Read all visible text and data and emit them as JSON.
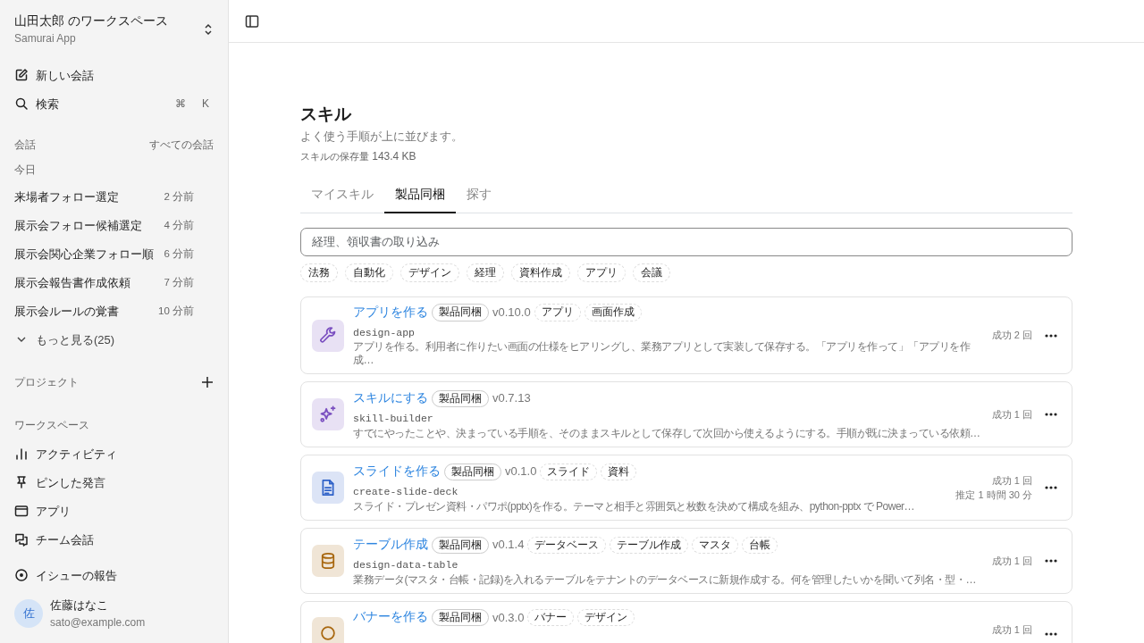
{
  "sidebar": {
    "workspace": {
      "title": "山田太郎 のワークスペース",
      "subtitle": "Samurai App"
    },
    "actions": [
      {
        "label": "新しい会話"
      },
      {
        "label": "検索",
        "keys": [
          "⌘",
          "K"
        ]
      }
    ],
    "conversations": {
      "heading": "会話",
      "link": "すべての会話",
      "group": "今日",
      "items": [
        {
          "title": "来場者フォロー選定",
          "time": "2 分前"
        },
        {
          "title": "展示会フォロー候補選定",
          "time": "4 分前"
        },
        {
          "title": "展示会関心企業フォロー順",
          "time": "6 分前"
        },
        {
          "title": "展示会報告書作成依頼",
          "time": "7 分前"
        },
        {
          "title": "展示会ルールの覚書",
          "time": "10 分前"
        }
      ],
      "more": "もっと見る(25)"
    },
    "projects": {
      "heading": "プロジェクト"
    },
    "workspace_section": {
      "heading": "ワークスペース",
      "items": [
        {
          "label": "アクティビティ"
        },
        {
          "label": "ピンした発言"
        },
        {
          "label": "アプリ"
        },
        {
          "label": "チーム会話"
        }
      ]
    },
    "report": {
      "label": "イシューの報告"
    },
    "user": {
      "initial": "佐",
      "name": "佐藤はなこ",
      "email": "sato@example.com"
    }
  },
  "page": {
    "title": "スキル",
    "subtitle": "よく使う手順が上に並びます。",
    "storage_label": "スキルの保存量",
    "storage_value": "143.4 KB",
    "tabs": [
      {
        "label": "マイスキル",
        "selected": false
      },
      {
        "label": "製品同梱",
        "selected": true
      },
      {
        "label": "探す",
        "selected": false
      }
    ],
    "search": {
      "placeholder": "経理、領収書の取り込み"
    },
    "filters": [
      "法務",
      "自動化",
      "デザイン",
      "経理",
      "資料作成",
      "アプリ",
      "会議"
    ],
    "skills": [
      {
        "color": "#7a4fc0",
        "title": "アプリを作る",
        "badge": "製品同梱",
        "version": "v0.10.0",
        "tags": [
          "アプリ",
          "画面作成"
        ],
        "code": "design-app",
        "description": "アプリを作る。利用者に作りたい画面の仕様をヒアリングし、業務アプリとして実装して保存する。「アプリを作って」「アプリを作成…",
        "stats": [
          "成功 2 回"
        ]
      },
      {
        "color": "#7a4fc0",
        "title": "スキルにする",
        "badge": "製品同梱",
        "version": "v0.7.13",
        "code": "skill-builder",
        "description": "すでにやったことや、決まっている手順を、そのままスキルとして保存して次回から使えるようにする。手順が既に決まっている依頼…",
        "stats": [
          "成功 1 回"
        ]
      },
      {
        "color": "#2f62c8",
        "title": "スライドを作る",
        "badge": "製品同梱",
        "version": "v0.1.0",
        "tags": [
          "スライド",
          "資料"
        ],
        "code": "create-slide-deck",
        "description": "スライド・プレゼン資料・パワポ(pptx)を作る。テーマと相手と雰囲気と枚数を決めて構成を組み、python-pptx で Power…",
        "stats": [
          "成功 1 回",
          "推定 1 時間 30 分"
        ]
      },
      {
        "color": "#a8670f",
        "title": "テーブル作成",
        "badge": "製品同梱",
        "version": "v0.1.4",
        "tags": [
          "データベース",
          "テーブル作成",
          "マスタ",
          "台帳"
        ],
        "code": "design-data-table",
        "description": "業務データ(マスタ・台帳・記録)を入れるテーブルをテナントのデータベースに新規作成する。何を管理したいかを聞いて列名・型・…",
        "stats": [
          "成功 1 回"
        ]
      },
      {
        "color": "#a8670f",
        "title": "バナーを作る",
        "badge": "製品同梱",
        "version": "v0.3.0",
        "tags": [
          "バナー",
          "デザイン"
        ],
        "stats": [
          "成功 1 回"
        ]
      }
    ]
  }
}
